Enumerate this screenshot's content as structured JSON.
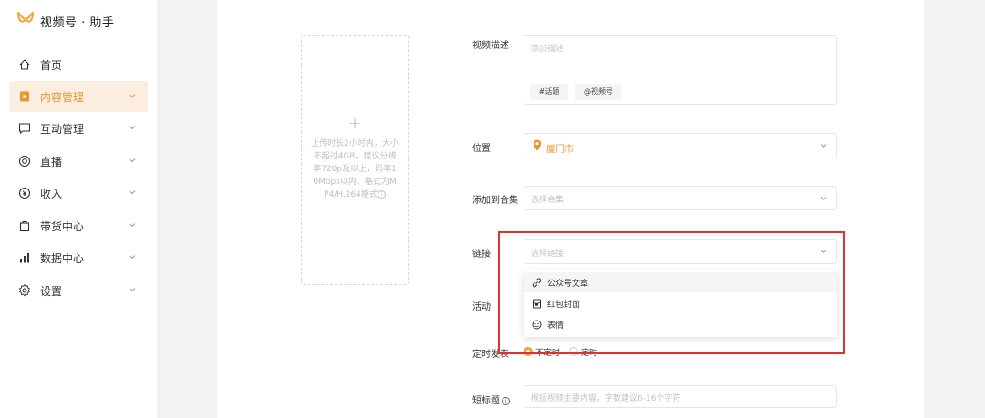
{
  "app": {
    "title": "视频号 · 助手",
    "accent": "#e8962e",
    "highlight_color": "#e0312f"
  },
  "sidebar": {
    "items": [
      {
        "label": "首页",
        "icon": "home-icon",
        "has_chevron": false
      },
      {
        "label": "内容管理",
        "icon": "video-content-icon",
        "has_chevron": true,
        "active": true
      },
      {
        "label": "互动管理",
        "icon": "chat-icon",
        "has_chevron": true
      },
      {
        "label": "直播",
        "icon": "live-icon",
        "has_chevron": true
      },
      {
        "label": "收入",
        "icon": "yen-icon",
        "has_chevron": true
      },
      {
        "label": "带货中心",
        "icon": "shopping-bag-icon",
        "has_chevron": true
      },
      {
        "label": "数据中心",
        "icon": "bar-chart-icon",
        "has_chevron": true
      },
      {
        "label": "设置",
        "icon": "gear-icon",
        "has_chevron": true
      }
    ]
  },
  "upload": {
    "plus": "+",
    "tip": "上传时长2小时内，大小不超过4GB，建议分辨率720p及以上，码率10Mbps以内，格式为MP4/H.264格式"
  },
  "form": {
    "description": {
      "label": "视频描述",
      "placeholder": "添加描述",
      "tags": [
        "#话题",
        "@视频号"
      ]
    },
    "location": {
      "label": "位置",
      "value": "厦门市"
    },
    "collection": {
      "label": "添加到合集",
      "placeholder": "选择合集"
    },
    "link": {
      "label": "链接",
      "placeholder": "选择链接"
    },
    "link_options": [
      {
        "label": "公众号文章",
        "icon": "link-icon"
      },
      {
        "label": "红包封面",
        "icon": "red-packet-icon"
      },
      {
        "label": "表情",
        "icon": "emoji-icon"
      }
    ],
    "activity": {
      "label": "活动"
    },
    "schedule": {
      "label": "定时发表",
      "options": [
        "不定时",
        "定时"
      ],
      "selected": "不定时"
    },
    "short_title": {
      "label": "短标题",
      "placeholder": "概括视频主要内容，字数建议6-16个字符"
    }
  }
}
